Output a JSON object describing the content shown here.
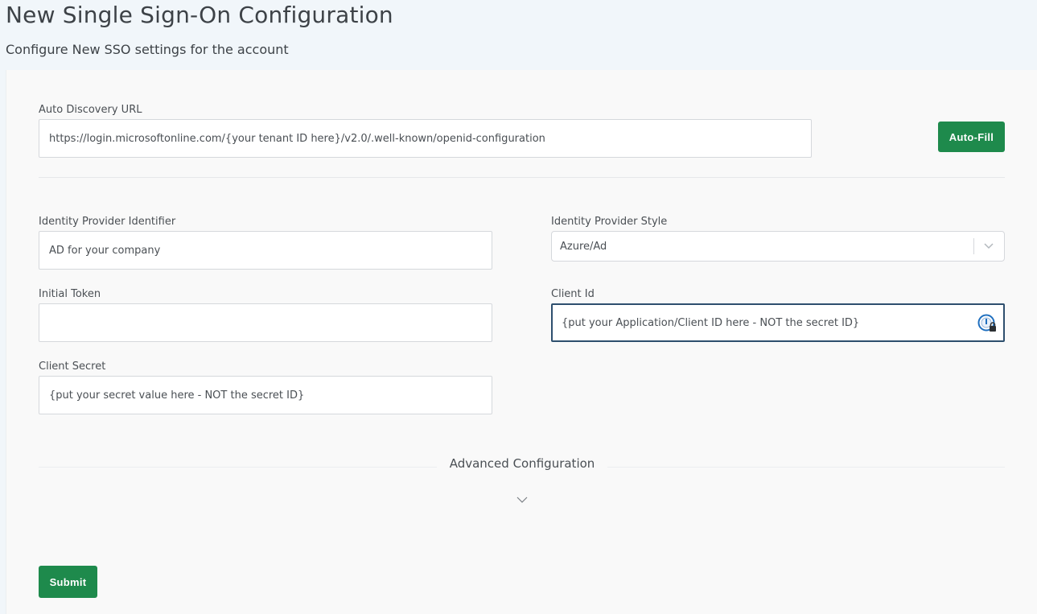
{
  "header": {
    "title": "New Single Sign-On Configuration",
    "subtitle": "Configure New SSO settings for the account"
  },
  "form": {
    "auto_discovery": {
      "label": "Auto Discovery URL",
      "value": "https://login.microsoftonline.com/{your tenant ID here}/v2.0/.well-known/openid-configuration",
      "autofill_label": "Auto-Fill"
    },
    "idp_identifier": {
      "label": "Identity Provider Identifier",
      "value": "AD for your company"
    },
    "idp_style": {
      "label": "Identity Provider Style",
      "value": "Azure/Ad"
    },
    "initial_token": {
      "label": "Initial Token",
      "value": ""
    },
    "client_id": {
      "label": "Client Id",
      "value": "{put your Application/Client ID here - NOT the secret ID}"
    },
    "client_secret": {
      "label": "Client Secret",
      "value": "{put your secret value here - NOT the secret ID}"
    },
    "advanced": {
      "label": "Advanced Configuration"
    },
    "submit_label": "Submit"
  },
  "colors": {
    "accent_green": "#1e8a4c",
    "focus_border": "#2e4f6e",
    "password_manager_blue": "#1f6fbf"
  },
  "icons": [
    "chevron-down-icon",
    "password-manager-icon",
    "lock-icon"
  ]
}
